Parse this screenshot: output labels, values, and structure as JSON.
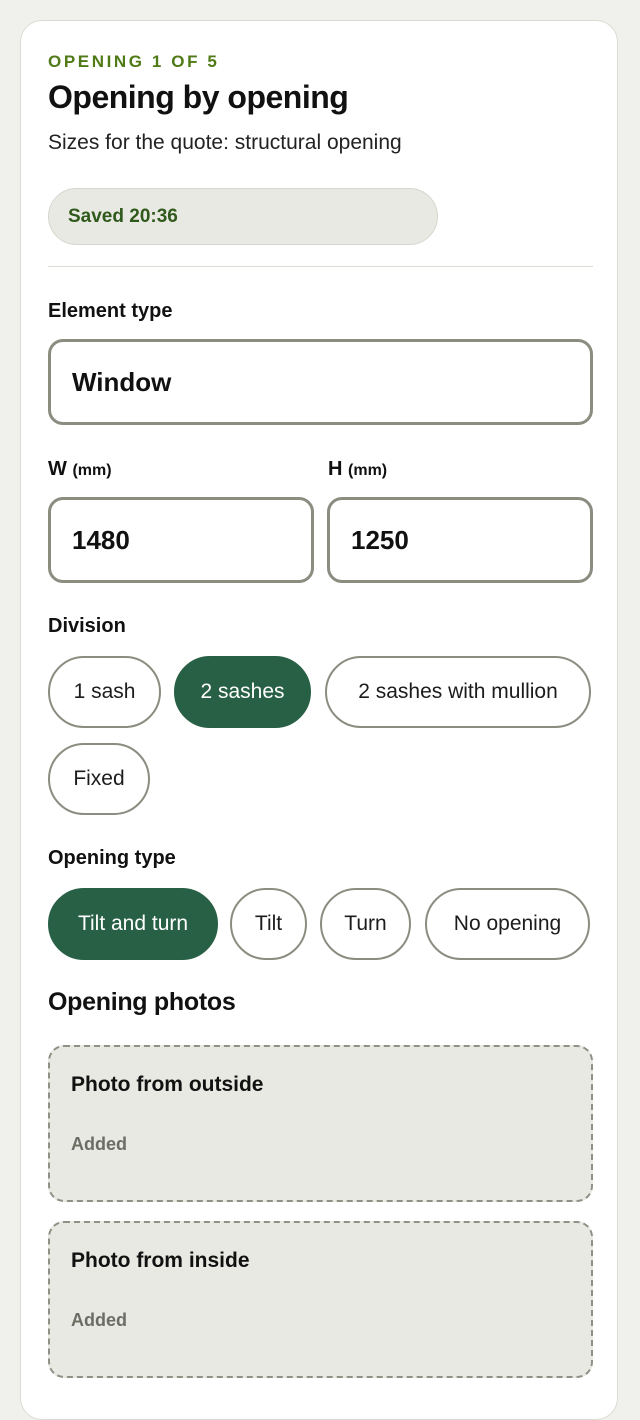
{
  "header": {
    "eyebrow": "OPENING 1 OF 5",
    "title": "Opening by opening",
    "subtitle": "Sizes for the quote: structural opening",
    "saved_status": "Saved 20:36"
  },
  "element_type": {
    "label": "Element type",
    "value": "Window"
  },
  "dimensions": {
    "width_label": "W",
    "width_unit": "(mm)",
    "width_value": "1480",
    "height_label": "H",
    "height_unit": "(mm)",
    "height_value": "1250"
  },
  "division": {
    "label": "Division",
    "options": [
      "1 sash",
      "2 sashes",
      "2 sashes with mullion",
      "Fixed"
    ],
    "selected": "2 sashes"
  },
  "opening_type": {
    "label": "Opening type",
    "options": [
      "Tilt and turn",
      "Tilt",
      "Turn",
      "No opening"
    ],
    "selected": "Tilt and turn"
  },
  "photos": {
    "title": "Opening photos",
    "items": [
      {
        "title": "Photo from outside",
        "status": "Added"
      },
      {
        "title": "Photo from inside",
        "status": "Added"
      }
    ]
  },
  "colors": {
    "accent": "#286046",
    "eyebrow": "#4f7a16",
    "saved_text": "#2f5a1c",
    "page_background": "#f0f0ec"
  }
}
